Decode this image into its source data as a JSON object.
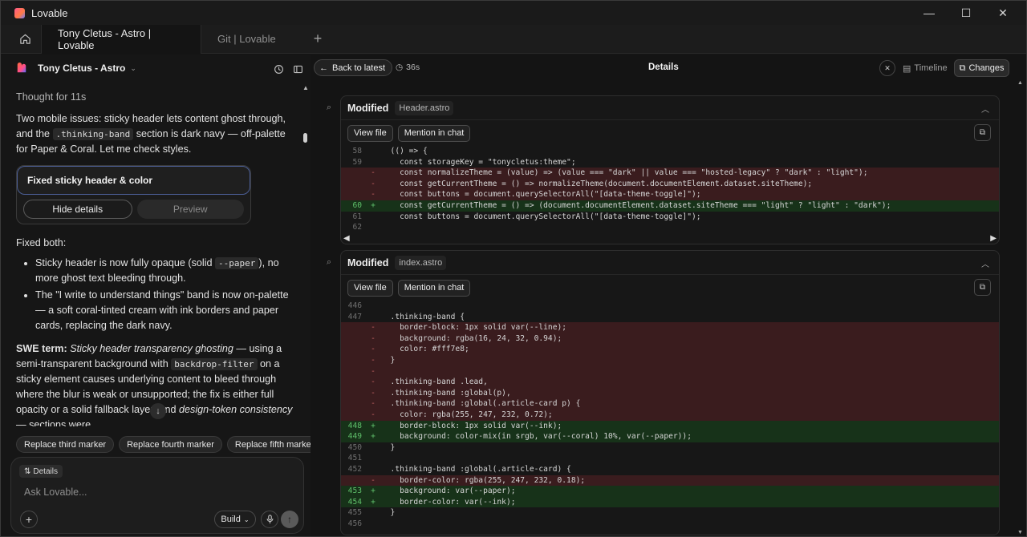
{
  "window": {
    "title": "Lovable",
    "controls": {
      "minimize": "—",
      "maximize": "☐",
      "close": "✕"
    }
  },
  "tabs": [
    {
      "label": "Tony Cletus - Astro | Lovable",
      "active": true
    },
    {
      "label": "Git | Lovable",
      "active": false
    }
  ],
  "tab_add": "+",
  "project": {
    "name": "Tony Cletus - Astro"
  },
  "chat": {
    "thought": "Thought for 11s",
    "p1_a": "Two mobile issues: sticky header lets content ghost through, and the ",
    "p1_code": ".thinking-band",
    "p1_b": " section is dark navy — off-palette for Paper & Coral. Let me check styles.",
    "card": {
      "title": "Fixed sticky header & color",
      "hide": "Hide details",
      "preview": "Preview"
    },
    "fixed": "Fixed both:",
    "b1_a": "Sticky header is now fully opaque (solid ",
    "b1_code": "--paper",
    "b1_b": "), no more ghost text bleeding through.",
    "b2": "The \"I write to understand things\" band is now on-palette — a soft coral-tinted cream with ink borders and paper cards, replacing the dark navy.",
    "swe_label": "SWE term:",
    "swe_term": "Sticky header transparency ghosting",
    "swe_a": " — using a semi-transparent background with ",
    "swe_code": "backdrop-filter",
    "swe_b": " on a sticky element causes underlying content to bleed through where the blur is weak or unsupported; the fix is either full opacity or a solid fallback layer. And ",
    "swe_term2": "design-token consistency",
    "swe_c": " — sections were"
  },
  "suggestions": [
    "Replace third marker",
    "Replace fourth marker",
    "Replace fifth marker"
  ],
  "composer": {
    "chip": "Details",
    "placeholder": "Ask Lovable...",
    "build": "Build"
  },
  "right_header": {
    "back": "Back to latest",
    "time": "36s",
    "title": "Details",
    "timeline": "Timeline",
    "changes": "Changes"
  },
  "files": [
    {
      "status": "Modified",
      "name": "Header.astro",
      "view": "View file",
      "mention": "Mention in chat",
      "lines": [
        {
          "n": "58",
          "m": "",
          "t": "  (() => {",
          "k": "ctx"
        },
        {
          "n": "59",
          "m": "",
          "t": "    const storageKey = \"tonycletus:theme\";",
          "k": "ctx"
        },
        {
          "n": "",
          "m": "-",
          "t": "    const normalizeTheme = (value) => (value === \"dark\" || value === \"hosted-legacy\" ? \"dark\" : \"light\");",
          "k": "del"
        },
        {
          "n": "",
          "m": "-",
          "t": "    const getCurrentTheme = () => normalizeTheme(document.documentElement.dataset.siteTheme);",
          "k": "del"
        },
        {
          "n": "",
          "m": "-",
          "t": "    const buttons = document.querySelectorAll(\"[data-theme-toggle]\");",
          "k": "del"
        },
        {
          "n": "60",
          "m": "+",
          "t": "    const getCurrentTheme = () => (document.documentElement.dataset.siteTheme === \"light\" ? \"light\" : \"dark\");",
          "k": "add"
        },
        {
          "n": "61",
          "m": "",
          "t": "    const buttons = document.querySelectorAll(\"[data-theme-toggle]\");",
          "k": "ctx"
        },
        {
          "n": "62",
          "m": "",
          "t": "",
          "k": "ctx"
        }
      ]
    },
    {
      "status": "Modified",
      "name": "index.astro",
      "view": "View file",
      "mention": "Mention in chat",
      "lines": [
        {
          "n": "446",
          "m": "",
          "t": "",
          "k": "ctx"
        },
        {
          "n": "447",
          "m": "",
          "t": "  .thinking-band {",
          "k": "ctx"
        },
        {
          "n": "",
          "m": "-",
          "t": "    border-block: 1px solid var(--line);",
          "k": "del"
        },
        {
          "n": "",
          "m": "-",
          "t": "    background: rgba(16, 24, 32, 0.94);",
          "k": "del"
        },
        {
          "n": "",
          "m": "-",
          "t": "    color: #fff7e8;",
          "k": "del"
        },
        {
          "n": "",
          "m": "-",
          "t": "  }",
          "k": "del"
        },
        {
          "n": "",
          "m": "-",
          "t": "",
          "k": "del"
        },
        {
          "n": "",
          "m": "-",
          "t": "  .thinking-band .lead,",
          "k": "del"
        },
        {
          "n": "",
          "m": "-",
          "t": "  .thinking-band :global(p),",
          "k": "del"
        },
        {
          "n": "",
          "m": "-",
          "t": "  .thinking-band :global(.article-card p) {",
          "k": "del"
        },
        {
          "n": "",
          "m": "-",
          "t": "    color: rgba(255, 247, 232, 0.72);",
          "k": "del"
        },
        {
          "n": "448",
          "m": "+",
          "t": "    border-block: 1px solid var(--ink);",
          "k": "add"
        },
        {
          "n": "449",
          "m": "+",
          "t": "    background: color-mix(in srgb, var(--coral) 10%, var(--paper));",
          "k": "add"
        },
        {
          "n": "450",
          "m": "",
          "t": "  }",
          "k": "ctx"
        },
        {
          "n": "451",
          "m": "",
          "t": "",
          "k": "ctx"
        },
        {
          "n": "452",
          "m": "",
          "t": "  .thinking-band :global(.article-card) {",
          "k": "ctx"
        },
        {
          "n": "",
          "m": "-",
          "t": "    border-color: rgba(255, 247, 232, 0.18);",
          "k": "del"
        },
        {
          "n": "453",
          "m": "+",
          "t": "    background: var(--paper);",
          "k": "add"
        },
        {
          "n": "454",
          "m": "+",
          "t": "    border-color: var(--ink);",
          "k": "add"
        },
        {
          "n": "455",
          "m": "",
          "t": "  }",
          "k": "ctx"
        },
        {
          "n": "456",
          "m": "",
          "t": "",
          "k": "ctx"
        }
      ]
    }
  ],
  "colors": {
    "del_bg": "#3a1c1e",
    "add_bg": "#173219",
    "accent_border": "#4b5e95"
  }
}
